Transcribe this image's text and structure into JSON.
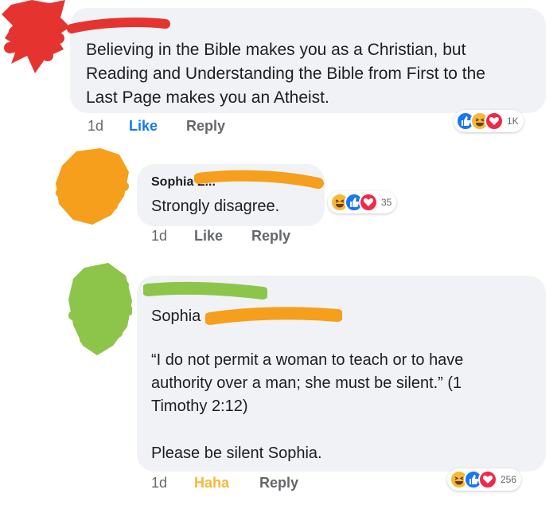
{
  "comment1": {
    "text_lines": [
      "Believing in the Bible makes you as a Christian, but",
      "Reading and Understanding the Bible from First to the",
      "Last Page makes you an Atheist."
    ],
    "time": "1d",
    "like_label": "Like",
    "reply_label": "Reply",
    "reaction_icons": [
      "like-icon",
      "haha-icon",
      "love-icon"
    ],
    "reaction_count": "1K"
  },
  "reply1": {
    "author": "Sophia L...",
    "text": "Strongly disagree.",
    "time": "1d",
    "like_label": "Like",
    "reply_label": "Reply",
    "reaction_icons": [
      "haha-icon",
      "like-icon",
      "love-icon"
    ],
    "reaction_count": "35"
  },
  "reply2": {
    "mention": "Sophia",
    "quote_lines": [
      "“I do not permit a woman to teach or to have",
      "authority over a man; she must be silent.” (1",
      "Timothy 2:12)"
    ],
    "closing": "Please be silent Sophia.",
    "time": "1d",
    "haha_label": "Haha",
    "reply_label": "Reply",
    "reaction_icons": [
      "haha-icon",
      "like-icon",
      "love-icon"
    ],
    "reaction_count": "256"
  },
  "colors": {
    "redaction_red": "#e5342f",
    "redaction_orange": "#f59f1c",
    "redaction_green": "#8dc54b",
    "like_blue": "#1877f2",
    "haha_yellow": "#f5b93a",
    "love_red": "#f0284a"
  }
}
